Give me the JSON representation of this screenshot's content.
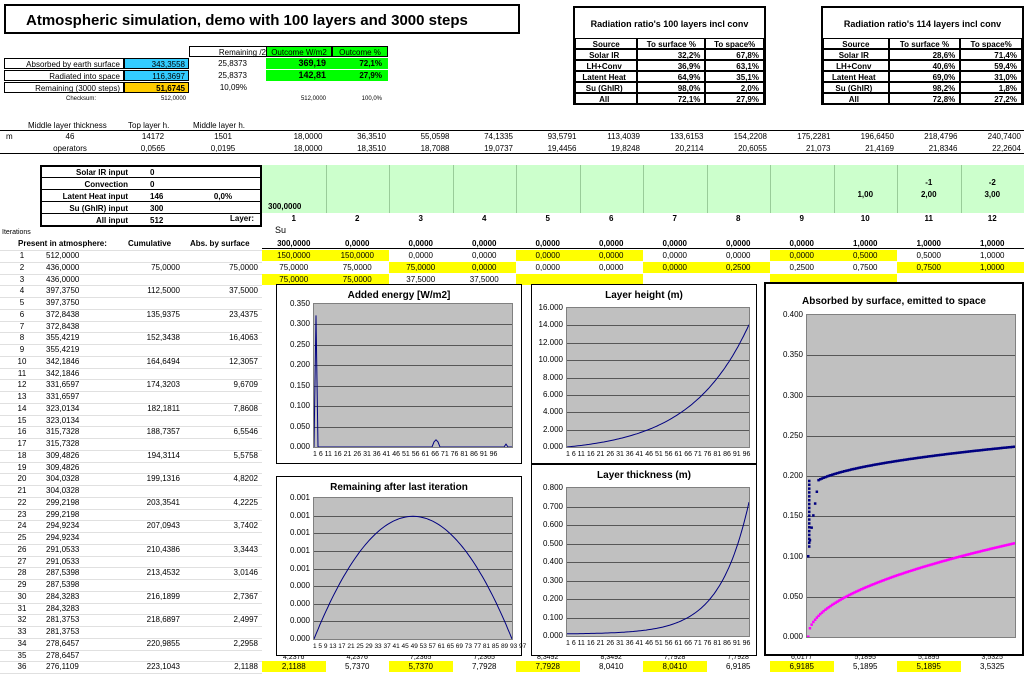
{
  "title": "Atmospheric simulation, demo with 100 layers and 3000 steps",
  "summary": {
    "headers": [
      "Remaining /2",
      "Outcome W/m2",
      "Outcome %"
    ],
    "rows": [
      {
        "label": "Absorbed by earth surface",
        "v": "343,3558",
        "half": "25,8373",
        "wm2": "369,19",
        "pct": "72,1%"
      },
      {
        "label": "Radiated into space",
        "v": "116,3697",
        "half": "25,8373",
        "wm2": "142,81",
        "pct": "27,9%"
      },
      {
        "label": "Remaining (3000 steps)",
        "v": "51,6745",
        "half": "10,09%",
        "wm2": "",
        "pct": ""
      }
    ],
    "checksum": {
      "label": "Checksum:",
      "v": "512,0000",
      "wm2": "512,0000",
      "pct": "100,0%"
    }
  },
  "ratio100": {
    "title": "Radiation ratio's 100 layers incl conv",
    "headers": [
      "Source",
      "To surface %",
      "To space%"
    ],
    "rows": [
      [
        "Solar IR",
        "32,2%",
        "67,8%"
      ],
      [
        "LH+Conv",
        "36,9%",
        "63,1%"
      ],
      [
        "Latent Heat",
        "64,9%",
        "35,1%"
      ],
      [
        "Su (GhIR)",
        "98,0%",
        "2,0%"
      ],
      [
        "All",
        "72,1%",
        "27,9%"
      ]
    ]
  },
  "ratio114": {
    "title": "Radiation ratio's 114 layers incl conv",
    "headers": [
      "Source",
      "To surface %",
      "To space%"
    ],
    "rows": [
      [
        "Solar IR",
        "28,6%",
        "71,4%"
      ],
      [
        "LH+Conv",
        "40,6%",
        "59,4%"
      ],
      [
        "Latent Heat",
        "69,0%",
        "31,0%"
      ],
      [
        "Su (GhIR)",
        "98,2%",
        "1,8%"
      ],
      [
        "All",
        "72,8%",
        "27,2%"
      ]
    ]
  },
  "layers": {
    "h1": "Middle layer thickness",
    "h2": "Top layer h.",
    "h3": "Middle layer h.",
    "unit": "m",
    "thick": "46",
    "top": "14172",
    "mid": "1501",
    "opLabel": "operators",
    "op1": "0,0565",
    "op2": "0,0195",
    "row1": [
      "18,0000",
      "36,3510",
      "55,0598",
      "74,1335",
      "93,5791",
      "113,4039",
      "133,6153",
      "154,2208",
      "175,2281",
      "196,6450",
      "218,4796",
      "240,7400"
    ],
    "row2": [
      "18,0000",
      "18,3510",
      "18,7088",
      "19,0737",
      "19,4456",
      "19,8248",
      "20,2114",
      "20,6055",
      "21,073",
      "21,4169",
      "21,8346",
      "22,2604"
    ]
  },
  "inputs": {
    "rows": [
      [
        "Solar IR input",
        "0",
        ""
      ],
      [
        "Convection",
        "0",
        ""
      ],
      [
        "Latent Heat input",
        "146",
        "0,0%"
      ],
      [
        "Su (GhIR) input",
        "300",
        ""
      ],
      [
        "All input",
        "512",
        ""
      ]
    ],
    "su_val": "300,0000",
    "layer_label": "Layer:",
    "layer_nums": [
      "1",
      "2",
      "3",
      "4",
      "5",
      "6",
      "7",
      "8",
      "9",
      "10",
      "11",
      "12"
    ],
    "latent_extra": [
      "-1",
      "-2"
    ],
    "latent_row": [
      "1,00",
      "2,00",
      "3,00"
    ]
  },
  "iter": {
    "label": "Iterations",
    "su": "Su",
    "present_label": "Present in atmosphere:",
    "cum_label": "Cumulative",
    "abs_label": "Abs. by surface",
    "present_vals": [
      "300,0000",
      "0,0000",
      "0,0000",
      "0,0000",
      "0,0000",
      "0,0000",
      "0,0000",
      "0,0000",
      "0,0000",
      "1,0000",
      "1,0000",
      "1,0000"
    ],
    "rows": [
      [
        "1",
        "512,0000",
        "",
        "",
        "150,0000",
        "150,0000",
        "0,0000",
        "0,0000",
        "0,0000",
        "0,0000",
        "0,0000",
        "0,0000",
        "0,0000",
        "0,5000",
        "0,5000",
        "1,0000"
      ],
      [
        "2",
        "436,0000",
        "75,0000",
        "75,0000",
        "75,0000",
        "75,0000",
        "75,0000",
        "0,0000",
        "0,0000",
        "0,0000",
        "0,0000",
        "0,2500",
        "0,2500",
        "0,7500",
        "0,7500",
        "1,0000"
      ],
      [
        "3",
        "436,0000",
        "",
        "",
        "75,0000",
        "75,0000",
        "37,5000",
        "37,5000",
        "",
        "",
        "",
        "",
        "",
        "",
        "",
        ""
      ],
      [
        "4",
        "397,3750",
        "112,5000",
        "37,5000"
      ],
      [
        "5",
        "397,3750",
        "",
        ""
      ],
      [
        "6",
        "372,8438",
        "135,9375",
        "23,4375"
      ],
      [
        "7",
        "372,8438",
        "",
        ""
      ],
      [
        "8",
        "355,4219",
        "152,3438",
        "16,4063"
      ],
      [
        "9",
        "355,4219",
        "",
        ""
      ],
      [
        "10",
        "342,1846",
        "164,6494",
        "12,3057"
      ],
      [
        "11",
        "342,1846",
        "",
        ""
      ],
      [
        "12",
        "331,6597",
        "174,3203",
        "9,6709"
      ],
      [
        "13",
        "331,6597",
        "",
        ""
      ],
      [
        "14",
        "323,0134",
        "182,1811",
        "7,8608"
      ],
      [
        "15",
        "323,0134",
        "",
        ""
      ],
      [
        "16",
        "315,7328",
        "188,7357",
        "6,5546"
      ],
      [
        "17",
        "315,7328",
        "",
        ""
      ],
      [
        "18",
        "309,4826",
        "194,3114",
        "5,5758"
      ],
      [
        "19",
        "309,4826",
        "",
        ""
      ],
      [
        "20",
        "304,0328",
        "199,1316",
        "4,8202"
      ],
      [
        "21",
        "304,0328",
        "",
        ""
      ],
      [
        "22",
        "299,2198",
        "203,3541",
        "4,2225"
      ],
      [
        "23",
        "299,2198",
        "",
        ""
      ],
      [
        "24",
        "294,9234",
        "207,0943",
        "3,7402"
      ],
      [
        "25",
        "294,9234",
        "",
        ""
      ],
      [
        "26",
        "291,0533",
        "210,4386",
        "3,3443"
      ],
      [
        "27",
        "291,0533",
        "",
        ""
      ],
      [
        "28",
        "287,5398",
        "213,4532",
        "3,0146"
      ],
      [
        "29",
        "287,5398",
        "",
        ""
      ],
      [
        "30",
        "284,3283",
        "216,1899",
        "2,7367"
      ],
      [
        "31",
        "284,3283",
        "",
        ""
      ],
      [
        "32",
        "281,3753",
        "218,6897",
        "2,4997"
      ],
      [
        "33",
        "281,3753",
        "",
        ""
      ],
      [
        "34",
        "278,6457",
        "220,9855",
        "2,2958"
      ],
      [
        "35",
        "278,6457",
        "",
        ""
      ],
      [
        "36",
        "276,1109",
        "223,1043",
        "2,1188"
      ]
    ],
    "row35_tail": [
      "4,2376",
      "4,2376",
      "7,2365",
      "7,2365",
      "8,3492",
      "8,3492",
      "7,7928",
      "7,7928",
      "6,0177",
      "5,1895",
      "5,1895",
      "3,5325"
    ],
    "row36_tail": [
      "2,1188",
      "5,7370",
      "5,7370",
      "7,7928",
      "7,7928",
      "8,0410",
      "8,0410",
      "6,9185",
      "6,9185",
      "5,1895",
      "5,1895",
      "3,5325"
    ]
  },
  "charts": {
    "added": {
      "title": "Added energy [W/m2]",
      "yt": [
        "0.350",
        "0.300",
        "0.250",
        "0.200",
        "0.150",
        "0.100",
        "0.050",
        "0.000"
      ],
      "xt": "1  6  11 16 21 26 31 36 41 46 51 56 61 66 71 76 81 86 91 96"
    },
    "height": {
      "title": "Layer height (m)",
      "yt": [
        "16.000",
        "14.000",
        "12.000",
        "10.000",
        "8.000",
        "6.000",
        "4.000",
        "2.000",
        "0.000"
      ],
      "xt": "1  6 11 16 21 26 31 36 41 46 51 56 61 66 71 76 81 86 91 96"
    },
    "remaining": {
      "title": "Remaining after last iteration",
      "yt": [
        "0.001",
        "0.001",
        "0.001",
        "0.001",
        "0.001",
        "0.000",
        "0.000",
        "0.000",
        "0.000"
      ],
      "xt": "1  5  9 13 17 21 25 29 33 37 41 45 49 53 57 61 65 69 73 77 81 85 89 93 97"
    },
    "thickness": {
      "title": "Layer thickness (m)",
      "yt": [
        "0.800",
        "0.700",
        "0.600",
        "0.500",
        "0.400",
        "0.300",
        "0.200",
        "0.100",
        "0.000"
      ],
      "xt": "1  6 11 16 21 26 31 36 41 46 51 56 61 66 71 76 81 86 91 96"
    },
    "absorbed": {
      "title": "Absorbed by surface, emitted to space",
      "yt": [
        "0.400",
        "0.350",
        "0.300",
        "0.250",
        "0.200",
        "0.150",
        "0.100",
        "0.050",
        "0.000"
      ],
      "colors": {
        "surface": "#000080",
        "space": "#ff00ff"
      }
    }
  }
}
